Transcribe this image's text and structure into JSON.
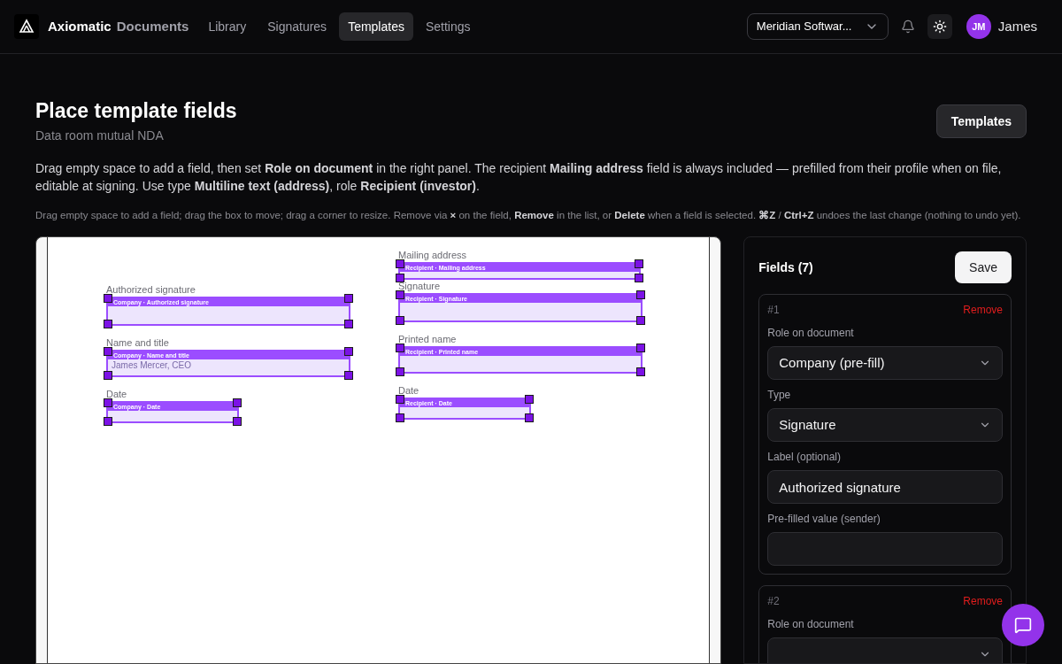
{
  "nav": {
    "brand": "Axiomatic",
    "brand_suffix": "Documents",
    "tabs": [
      {
        "label": "Library",
        "selected": false
      },
      {
        "label": "Signatures",
        "selected": false
      },
      {
        "label": "Templates",
        "selected": true
      },
      {
        "label": "Settings",
        "selected": false
      }
    ],
    "org": "Meridian Softwar...",
    "user": {
      "initials": "JM",
      "name": "James"
    }
  },
  "page": {
    "title": "Place template fields",
    "subtitle": "Data room mutual NDA",
    "action": "Templates",
    "intro": "Drag empty space to add a field, then set **Role on document** in the right panel. The recipient **Mailing address** field is always included — prefilled from their profile when on file, editable at signing. Use type **Multiline text (address)**, role **Recipient (investor)**.",
    "hint": "Drag empty space to add a field; drag the box to move; drag a corner to resize. Remove via **×** on the field, **Remove** in the list, or **Delete** when a field is selected. **⌘Z** / **Ctrl+Z** undoes the last change (nothing to undo yet)."
  },
  "document": {
    "columns": [
      {
        "fields": [
          {
            "kind": "signature",
            "label": "Authorized signature",
            "tag": "Company · Authorized signature"
          },
          {
            "kind": "text",
            "label": "Name and title",
            "tag": "Company · Name and title",
            "value": "James Mercer, CEO"
          },
          {
            "kind": "date",
            "label": "Date",
            "tag": "Company · Date"
          }
        ]
      },
      {
        "fields": [
          {
            "kind": "address",
            "label": "Mailing address",
            "tag": "Recipient · Mailing address"
          },
          {
            "kind": "signature",
            "label": "Signature",
            "tag": "Recipient · Signature"
          },
          {
            "kind": "text",
            "label": "Printed name",
            "tag": "Recipient · Printed name"
          },
          {
            "kind": "date",
            "label": "Date",
            "tag": "Recipient · Date"
          }
        ]
      }
    ]
  },
  "panel": {
    "title": "Fields (7)",
    "save": "Save",
    "cards": [
      {
        "number": "#1",
        "remove": "Remove",
        "inputs": [
          {
            "kind": "select",
            "label": "Role on document",
            "value": "Company (pre-fill)"
          },
          {
            "kind": "select",
            "label": "Type",
            "value": "Signature"
          },
          {
            "kind": "text",
            "label": "Label (optional)",
            "value": "Authorized signature"
          },
          {
            "kind": "text",
            "label": "Pre-filled value (sender)"
          }
        ]
      },
      {
        "number": "#2",
        "remove": "Remove",
        "inputs": [
          {
            "kind": "select",
            "label": "Role on document"
          }
        ]
      }
    ]
  }
}
